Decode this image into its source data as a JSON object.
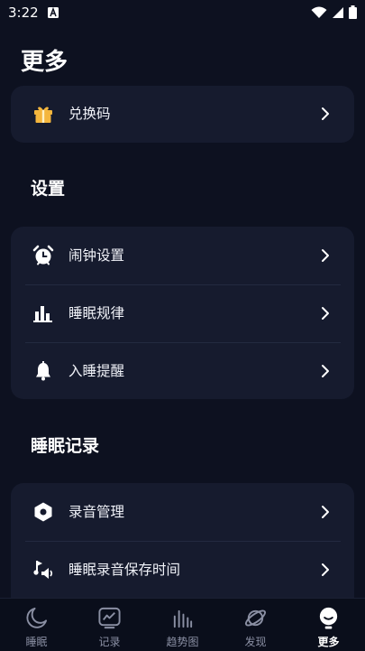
{
  "status_bar": {
    "time": "3:22"
  },
  "page": {
    "title": "更多"
  },
  "redeem": {
    "label": "兑换码",
    "icon": "gift-icon"
  },
  "settings": {
    "title": "设置",
    "items": [
      {
        "label": "闹钟设置",
        "icon": "alarm-clock-icon"
      },
      {
        "label": "睡眠规律",
        "icon": "bar-chart-icon"
      },
      {
        "label": "入睡提醒",
        "icon": "bell-icon"
      }
    ]
  },
  "sleep_records": {
    "title": "睡眠记录",
    "items": [
      {
        "label": "录音管理",
        "icon": "hexagon-icon"
      },
      {
        "label": "睡眠录音保存时间",
        "icon": "speaker-note-icon"
      }
    ]
  },
  "bottom_nav": {
    "items": [
      {
        "label": "睡眠",
        "icon": "moon-icon"
      },
      {
        "label": "记录",
        "icon": "chart-tv-icon"
      },
      {
        "label": "趋势图",
        "icon": "bars-icon"
      },
      {
        "label": "发现",
        "icon": "planet-icon"
      },
      {
        "label": "更多",
        "icon": "bulb-icon",
        "active": true
      }
    ]
  },
  "colors": {
    "background": "#0d1120",
    "card": "#161b2e",
    "gift": "#f4b63d"
  }
}
